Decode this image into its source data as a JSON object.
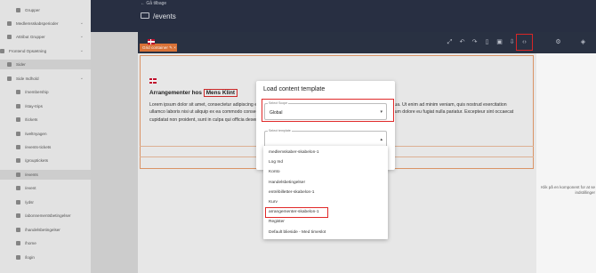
{
  "sidebar": {
    "items": [
      {
        "label": "Grupper",
        "active": false,
        "chevron": false
      },
      {
        "label": "Medlemsskabsperioder",
        "active": false,
        "chevron": true
      },
      {
        "label": "Attribut Grupper",
        "active": false,
        "chevron": true
      },
      {
        "label": "Frontend Opsætning",
        "active": false,
        "chevron": true
      },
      {
        "label": "Sider",
        "active": true,
        "chevron": false
      },
      {
        "label": "Side Indhold",
        "active": false,
        "chevron": true
      },
      {
        "label": "/membership",
        "active": false,
        "chevron": false
      },
      {
        "label": "/stay-trips",
        "active": false,
        "chevron": false
      },
      {
        "label": "/tickets",
        "active": false,
        "chevron": false
      },
      {
        "label": "/weltnyagen",
        "active": false,
        "chevron": false
      },
      {
        "label": "/events-tickets",
        "active": false,
        "chevron": false
      },
      {
        "label": "/grouptickets",
        "active": false,
        "chevron": false
      },
      {
        "label": "/events",
        "active": true,
        "chevron": false
      },
      {
        "label": "/event",
        "active": false,
        "chevron": false
      },
      {
        "label": "/ydsr",
        "active": false,
        "chevron": false
      },
      {
        "label": "/abonnementsbetingelser",
        "active": false,
        "chevron": false
      },
      {
        "label": "/handelsbetingelser",
        "active": false,
        "chevron": false
      },
      {
        "label": "/home",
        "active": false,
        "chevron": false
      },
      {
        "label": "/login",
        "active": false,
        "chevron": false
      }
    ]
  },
  "header": {
    "back_label": "← Gå tilbage",
    "title": "/events"
  },
  "canvas": {
    "container_tag": "Grid container ✎ ×",
    "heading_prefix": "Arrangementer hos ",
    "heading_name": "Mens Klint",
    "lorem": "Lorem ipsum dolor sit amet, consectetur adipiscing elit, sed do eiusmod tempor incididunt ut labore et dolore magna aliqua. Ut enim ad minim veniam, quis nostrud exercitation ullamco laboris nisi ut aliquip ex ea commodo consequat. Duis aute irure dolor in reprehenderit in voluptate velit esse cillum dolore eu fugiat nulla pariatur. Excepteur sint occaecat cupidatat non proident, sunt in culpa qui officia deserunt mollit anim id est laborum."
  },
  "right_panel": {
    "hint": "Klik på en komponent for at se indstillinger"
  },
  "modal": {
    "title": "Load content template",
    "scope_label": "Select Scope",
    "scope_value": "Global",
    "template_label": "Select template",
    "template_value": "",
    "options": [
      "medlemskaber-skabelon-1",
      "Log Ind",
      "Konto",
      "Handelsbetingelser",
      "entrébilletter-skabelon-1",
      "Kurv",
      "arrangementer-skabelon-1",
      "Register",
      "Default blieside - Med timeslot"
    ]
  },
  "colors": {
    "header_bg": "#2a3145",
    "accent_orange": "#e2773a",
    "highlight_red": "#e02828"
  }
}
